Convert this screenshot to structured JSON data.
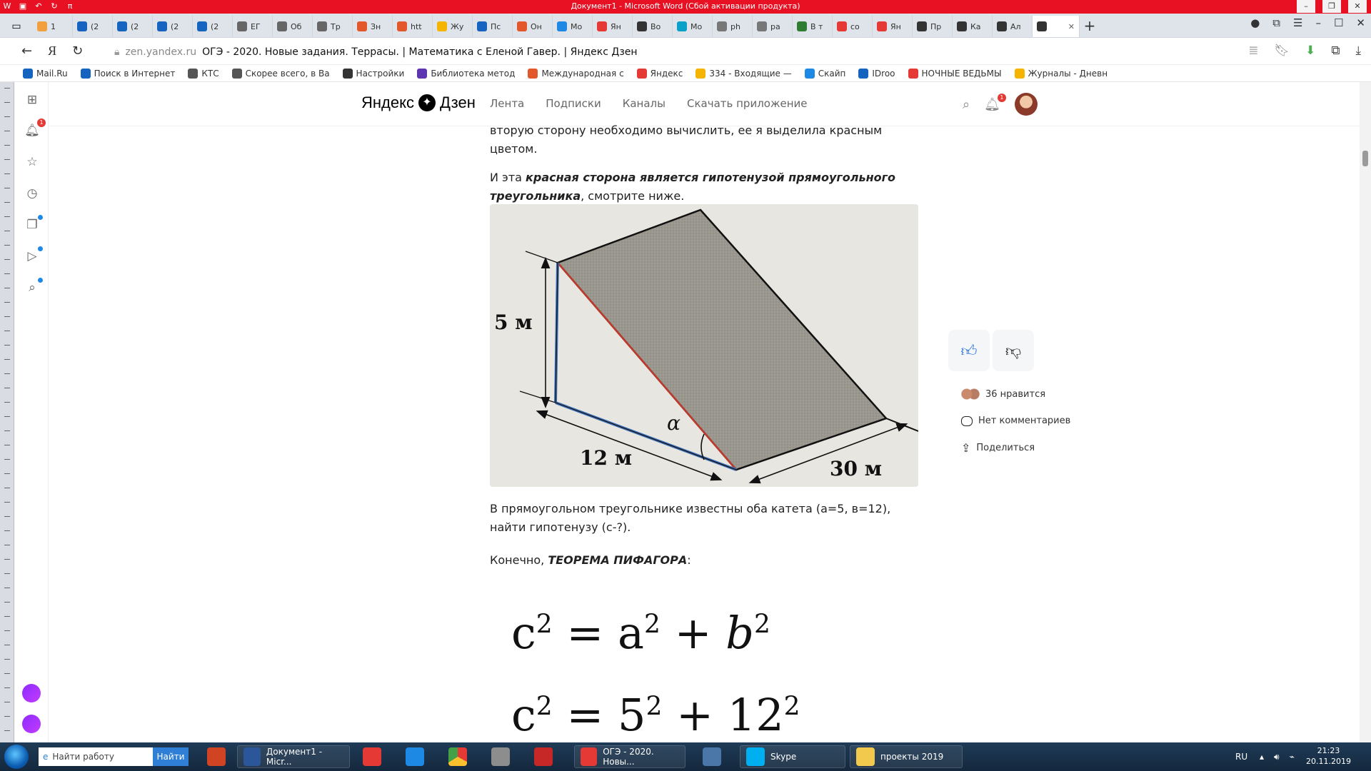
{
  "word": {
    "title": "Документ1 - Microsoft Word (Сбой активации продукта)"
  },
  "tabs": [
    {
      "label": "1 ",
      "color": "#f2a03d"
    },
    {
      "label": "(2",
      "color": "#1565c0"
    },
    {
      "label": "(2",
      "color": "#1565c0"
    },
    {
      "label": "(2",
      "color": "#1565c0"
    },
    {
      "label": "(2",
      "color": "#1565c0"
    },
    {
      "label": "ЕГ",
      "color": "#666"
    },
    {
      "label": "Об",
      "color": "#666"
    },
    {
      "label": "Тр",
      "color": "#666"
    },
    {
      "label": "Зн",
      "color": "#e2582b"
    },
    {
      "label": "htt",
      "color": "#e2582b"
    },
    {
      "label": "Жу",
      "color": "#f4b400"
    },
    {
      "label": "Пс",
      "color": "#1565c0"
    },
    {
      "label": "Он",
      "color": "#e2582b"
    },
    {
      "label": "Мо",
      "color": "#1e88e5"
    },
    {
      "label": "Ян",
      "color": "#e53935"
    },
    {
      "label": "Во",
      "color": "#333"
    },
    {
      "label": "Мо",
      "color": "#0aa0c8"
    },
    {
      "label": "ph",
      "color": "#777"
    },
    {
      "label": "ра",
      "color": "#777"
    },
    {
      "label": "В т",
      "color": "#2e7d32"
    },
    {
      "label": "со",
      "color": "#e53935"
    },
    {
      "label": "Ян",
      "color": "#e53935"
    },
    {
      "label": "Пр",
      "color": "#333"
    },
    {
      "label": "Ка",
      "color": "#333"
    },
    {
      "label": "Ал",
      "color": "#333"
    }
  ],
  "address": {
    "domain": "zen.yandex.ru",
    "title": "ОГЭ - 2020. Новые задания. Террасы. | Математика с Еленой Гавер. | Яндекс Дзен"
  },
  "bookmarks": [
    {
      "label": "Mail.Ru",
      "color": "#1565c0"
    },
    {
      "label": "Поиск в Интернет",
      "color": "#1565c0"
    },
    {
      "label": "КТС",
      "color": "#555"
    },
    {
      "label": "Скорее всего, в Ва",
      "color": "#555"
    },
    {
      "label": "Настройки",
      "color": "#333"
    },
    {
      "label": "Библиотека метод",
      "color": "#5e35b1"
    },
    {
      "label": "Международная с",
      "color": "#e2582b"
    },
    {
      "label": "Яндекс",
      "color": "#e53935"
    },
    {
      "label": "334 - Входящие —",
      "color": "#f4b400"
    },
    {
      "label": "Скайп",
      "color": "#1e88e5"
    },
    {
      "label": "IDroo",
      "color": "#1565c0"
    },
    {
      "label": "НОЧНЫЕ ВЕДЬМЫ",
      "color": "#e53935"
    },
    {
      "label": "Журналы - Дневн",
      "color": "#f4b400"
    }
  ],
  "zen": {
    "logo_text": "Яндекс",
    "logo_name": "Дзен",
    "nav": [
      "Лента",
      "Подписки",
      "Каналы",
      "Скачать приложение"
    ],
    "notif_count": "1"
  },
  "article": {
    "p0": "вторую сторону необходимо вычислить, ее я выделила красным цветом.",
    "p1_pre": "И эта ",
    "p1_bold": "красная сторона является гипотенузой прямоугольного треугольника",
    "p1_post": ", смотрите ниже.",
    "p2": "В прямоугольном треугольнике известны оба катета (а=5, в=12), найти гипотенузу (с-?).",
    "p3_pre": "Конечно, ",
    "p3_bold": "ТЕОРЕМА ПИФАГОРА",
    "p3_post": ":",
    "figure_labels": {
      "h": "5 м",
      "base": "12 м",
      "len": "30 м",
      "angle": "α"
    },
    "formula1": {
      "lhs": "c",
      "rhs1": "a",
      "rhs2": "b"
    },
    "formula2": {
      "lhs": "c",
      "rhs1": "5",
      "rhs2": "12"
    }
  },
  "actions": {
    "likes": "36 нравится",
    "comments": "Нет комментариев",
    "share": "Поделиться"
  },
  "taskbar": {
    "search_placeholder": "Найти работу",
    "search_btn": "Найти",
    "word": "Документ1 - Micr...",
    "browser": "ОГЭ - 2020. Новы...",
    "skype": "Skype",
    "folder": "проекты 2019",
    "lang": "RU",
    "time": "21:23",
    "date": "20.11.2019"
  }
}
